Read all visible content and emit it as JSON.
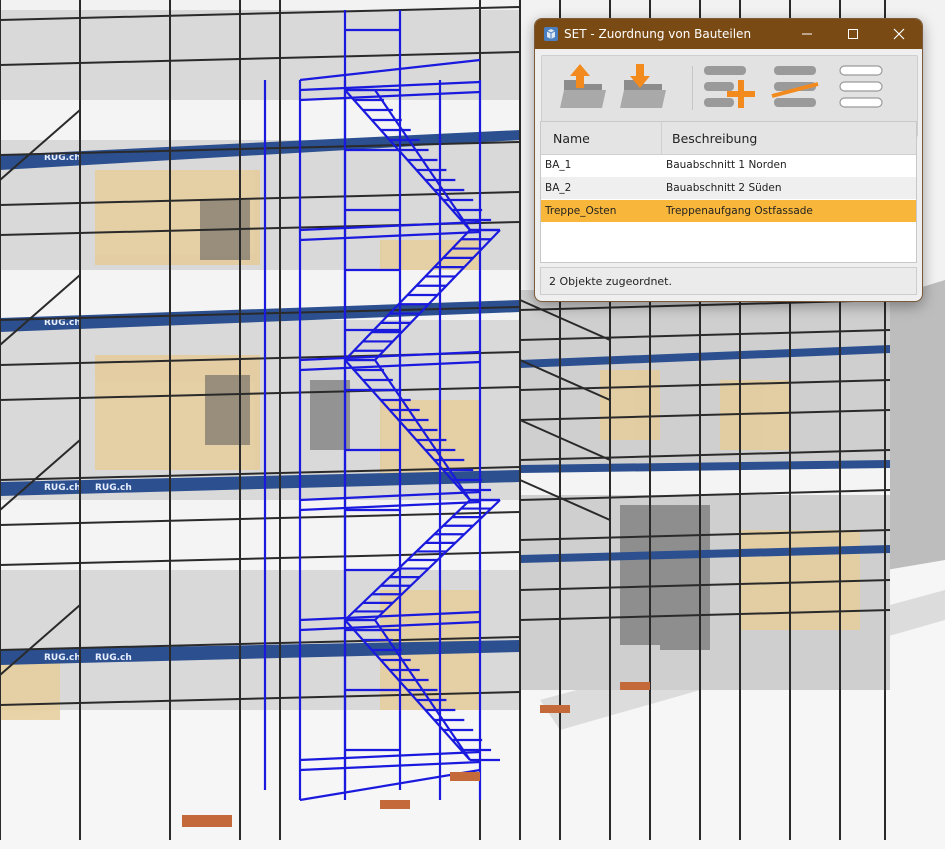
{
  "window": {
    "title": "SET - Zuordnung von Bauteilen",
    "accent": "#7a4a14",
    "controls": [
      "minimize",
      "maximize",
      "close"
    ]
  },
  "toolbar": {
    "tools": [
      {
        "name": "export-to-folder-icon"
      },
      {
        "name": "import-from-folder-icon"
      },
      {
        "name": "add-item-icon"
      },
      {
        "name": "remove-item-icon"
      },
      {
        "name": "list-view-icon"
      }
    ]
  },
  "table": {
    "columns": [
      "Name",
      "Beschreibung"
    ],
    "rows": [
      {
        "name": "BA_1",
        "description": "Bauabschnitt 1 Norden",
        "selected": false
      },
      {
        "name": "BA_2",
        "description": "Bauabschnitt 2 Süden",
        "selected": false
      },
      {
        "name": "Treppe_Osten",
        "description": "Treppenaufgang Ostfassade",
        "selected": true
      }
    ],
    "selection_color": "#f8b73a"
  },
  "status": {
    "text": "2 Objekte zugeordnet."
  },
  "scene": {
    "brand_label": "RUG.ch",
    "scaffold_color": "#2c4f8f",
    "stair_color": "#1a1adf"
  }
}
